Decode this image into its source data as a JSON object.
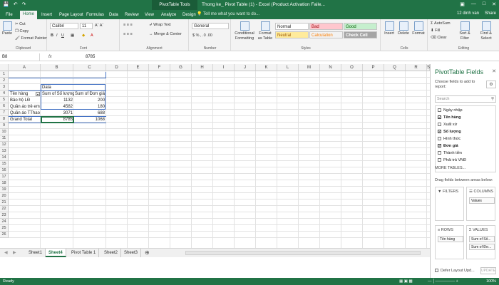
{
  "window": {
    "title": "Thong ke_ Pivot Table (1) - Excel (Product Activation Faile...",
    "context_tab_group": "PivotTable Tools",
    "user": "12 dinh van",
    "share": "Share"
  },
  "menu_tabs": [
    "File",
    "Home",
    "Insert",
    "Page Layout",
    "Formulas",
    "Data",
    "Review",
    "View",
    "Analyze",
    "Design"
  ],
  "active_tab": "Home",
  "tell_me": "Tell me what you want to do...",
  "ribbon": {
    "clipboard": {
      "paste": "Paste",
      "cut": "Cut",
      "copy": "Copy",
      "format_painter": "Format Painter",
      "label": "Clipboard"
    },
    "font": {
      "name": "Calibri",
      "size": "11",
      "label": "Font"
    },
    "alignment": {
      "wrap": "Wrap Text",
      "merge": "Merge & Center",
      "label": "Alignment"
    },
    "number": {
      "format": "General",
      "label": "Number"
    },
    "styles": {
      "conditional": "Conditional Formatting",
      "format_as_table": "Format as Table",
      "normal": "Normal",
      "bad": "Bad",
      "good": "Good",
      "neutral": "Neutral",
      "calculation": "Calculation",
      "check_cell": "Check Cell",
      "label": "Styles"
    },
    "cells": {
      "insert": "Insert",
      "delete": "Delete",
      "format": "Format",
      "label": "Cells"
    },
    "editing": {
      "autosum": "AutoSum",
      "fill": "Fill",
      "clear": "Clear",
      "sort": "Sort & Filter",
      "find": "Find & Select",
      "label": "Editing"
    }
  },
  "formula_bar": {
    "name_box": "B8",
    "fx": "fx",
    "value": "8785"
  },
  "columns": [
    "A",
    "B",
    "C",
    "D",
    "E",
    "F",
    "G",
    "H",
    "I",
    "J",
    "K",
    "L",
    "M",
    "N",
    "O",
    "P",
    "Q",
    "R",
    "S"
  ],
  "rows": [
    "1",
    "2",
    "3",
    "4",
    "5",
    "6",
    "7",
    "8",
    "9",
    "10",
    "11",
    "12",
    "13",
    "14",
    "15",
    "16",
    "17",
    "18",
    "19",
    "20",
    "21",
    "22",
    "23",
    "24",
    "25",
    "26"
  ],
  "pivot": {
    "data_label": "Data",
    "row_header": "Tên hàng",
    "col1": "Sum of Số lượng",
    "col2": "Sum of Đơn giá",
    "rows": [
      {
        "name": "Bảo hộ LĐ",
        "qty": "1132",
        "price": "200"
      },
      {
        "name": "Quần áo trẻ em",
        "qty": "4582",
        "price": "180"
      },
      {
        "name": "Quần áo TThao",
        "qty": "3071",
        "price": "688"
      }
    ],
    "grand_total": {
      "name": "Grand Total",
      "qty": "8785",
      "price": "1068"
    }
  },
  "sheets": [
    "Sheet1",
    "Sheet4",
    "Pivot Table 1",
    "Sheet2",
    "Sheet3"
  ],
  "active_sheet": "Sheet4",
  "status": {
    "ready": "Ready",
    "zoom": "100%"
  },
  "pivot_pane": {
    "title": "PivotTable Fields",
    "choose": "Choose fields to add to report:",
    "search_placeholder": "Search",
    "fields": [
      {
        "label": "Ngày nhập",
        "checked": false
      },
      {
        "label": "Tên hàng",
        "checked": true
      },
      {
        "label": "Xuất xứ",
        "checked": false
      },
      {
        "label": "Số lượng",
        "checked": true
      },
      {
        "label": "Hình thức",
        "checked": false
      },
      {
        "label": "Đơn giá",
        "checked": true
      },
      {
        "label": "Thành tiền",
        "checked": false
      },
      {
        "label": "Phải trả VNĐ",
        "checked": false
      }
    ],
    "more_tables": "MORE TABLES...",
    "drag_text": "Drag fields between areas below:",
    "filters": "FILTERS",
    "columns": "COLUMNS",
    "rows": "ROWS",
    "values": "VALUES",
    "columns_chip": "Values",
    "rows_chip": "Tên hàng",
    "values_chips": [
      "Sum of Số...",
      "Sum of Đơ..."
    ],
    "defer": "Defer Layout Upd...",
    "update": "UPDATE"
  }
}
